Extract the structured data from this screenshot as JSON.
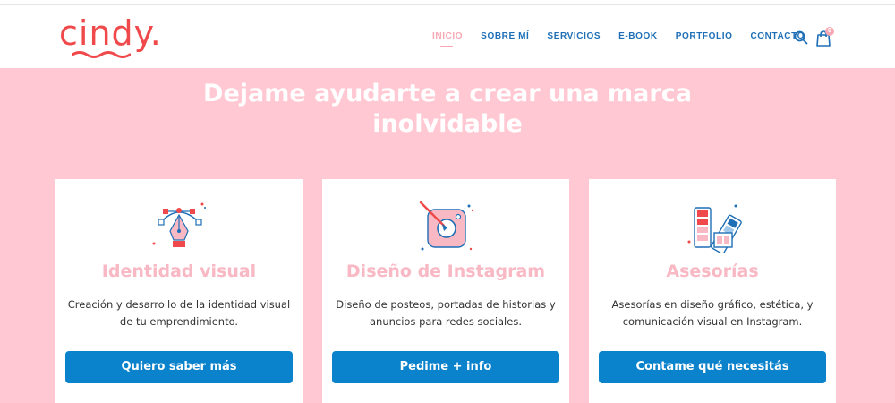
{
  "logo": {
    "text": "cindy."
  },
  "nav": {
    "items": [
      {
        "label": "INICIO",
        "active": true
      },
      {
        "label": "SOBRE MÍ"
      },
      {
        "label": "SERVICIOS"
      },
      {
        "label": "E-BOOK"
      },
      {
        "label": "PORTFOLIO"
      },
      {
        "label": "CONTACTO"
      }
    ],
    "cart_count": "0"
  },
  "hero": {
    "title_line1": "Dejame ayudarte a crear una marca",
    "title_line2": "inolvidable"
  },
  "cards": [
    {
      "icon": "pen-tool-icon",
      "title": "Identidad visual",
      "description": "Creación y desarrollo de la identidad visual de tu emprendimiento.",
      "button": "Quiero saber más"
    },
    {
      "icon": "instagram-design-icon",
      "title": "Diseño de Instagram",
      "description": "Diseño de posteos, portadas de historias y anuncios para redes sociales.",
      "button": "Pedime + info"
    },
    {
      "icon": "color-swatch-icon",
      "title": "Asesorías",
      "description": "Asesorías en diseño gráfico, estética, y comunicación visual en Instagram.",
      "button": "Contame qué necesitás"
    }
  ],
  "colors": {
    "brand": "#f0494b",
    "pink": "#ffc8d2",
    "accent_blue": "#0b82cc",
    "nav_blue": "#1f6fb7",
    "title_pink": "#f8b8c4"
  }
}
